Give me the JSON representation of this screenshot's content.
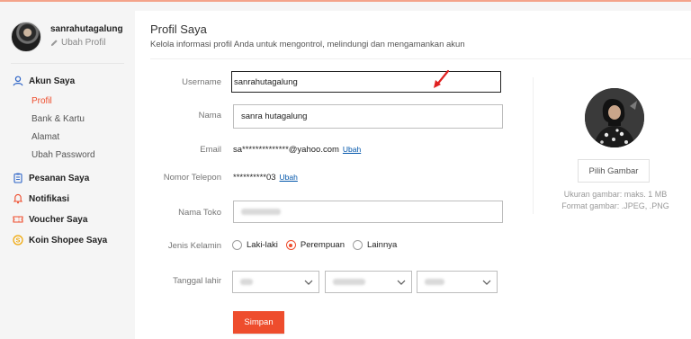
{
  "sidebar": {
    "username": "sanrahutagalung",
    "edit_profile": "Ubah Profil",
    "menu": {
      "akun": "Akun Saya",
      "profil": "Profil",
      "bank": "Bank & Kartu",
      "alamat": "Alamat",
      "password": "Ubah Password",
      "pesanan": "Pesanan Saya",
      "notifikasi": "Notifikasi",
      "voucher": "Voucher Saya",
      "koin": "Koin Shopee Saya"
    }
  },
  "main": {
    "title": "Profil Saya",
    "subtitle": "Kelola informasi profil Anda untuk mengontrol, melindungi dan mengamankan akun",
    "fields": {
      "username_label": "Username",
      "username_value": "sanrahutagalung",
      "nama_label": "Nama",
      "nama_value": "sanra hutagalung",
      "email_label": "Email",
      "email_value": "sa**************@yahoo.com",
      "email_change": "Ubah",
      "phone_label": "Nomor Telepon",
      "phone_value": "**********03",
      "phone_change": "Ubah",
      "toko_label": "Nama Toko",
      "gender_label": "Jenis Kelamin",
      "gender_options": [
        "Laki-laki",
        "Perempuan",
        "Lainnya"
      ],
      "gender_selected": "Perempuan",
      "dob_label": "Tanggal lahir"
    },
    "save_label": "Simpan",
    "photo": {
      "pick_label": "Pilih Gambar",
      "size_hint": "Ukuran gambar: maks. 1 MB",
      "format_hint": "Format gambar: .JPEG, .PNG"
    }
  },
  "colors": {
    "accent": "#ee4d2d",
    "link": "#0055aa"
  }
}
